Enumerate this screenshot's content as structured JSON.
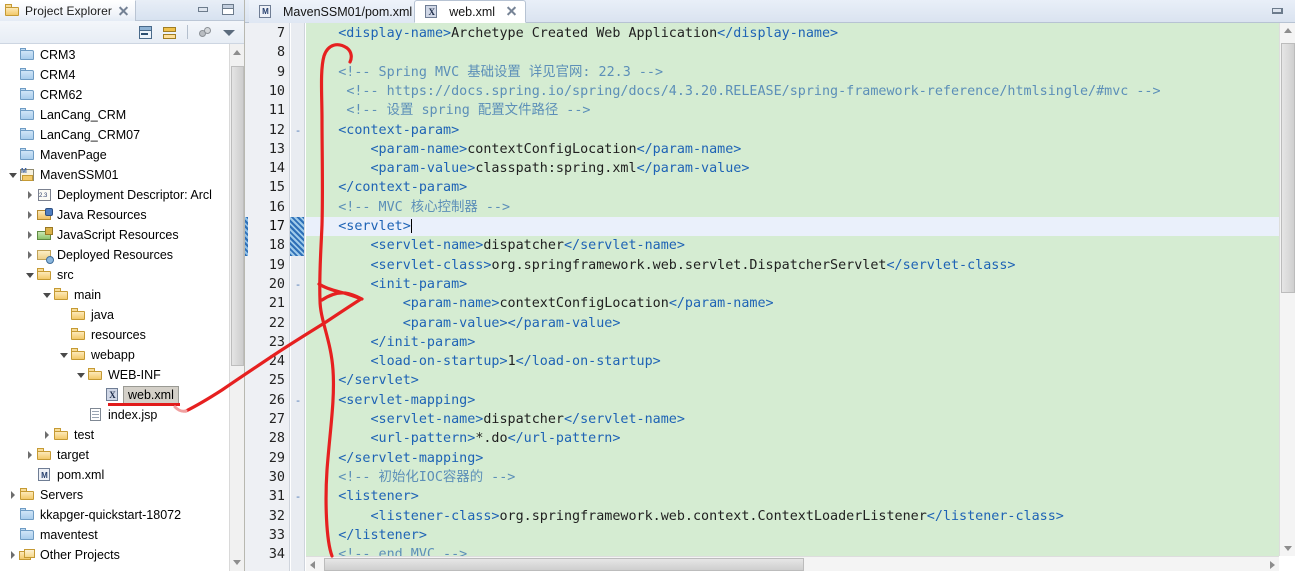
{
  "window": {
    "restore_label": "restore-down"
  },
  "explorer": {
    "tab_title": "Project Explorer",
    "close_icon": "close-icon",
    "minimize_icon": "minimize-icon",
    "maximize_icon": "maximize-icon",
    "toolbar": {
      "collapse_all": "collapse-all-icon",
      "link_with_editor": "link-with-editor-icon",
      "filter": "filter-icon",
      "view_menu": "view-menu-icon"
    },
    "tree": [
      {
        "label": "CRM3",
        "indent": 0,
        "twisty": "none",
        "icon": "folder-blue"
      },
      {
        "label": "CRM4",
        "indent": 0,
        "twisty": "none",
        "icon": "folder-blue"
      },
      {
        "label": "CRM62",
        "indent": 0,
        "twisty": "none",
        "icon": "folder-blue"
      },
      {
        "label": "LanCang_CRM",
        "indent": 0,
        "twisty": "none",
        "icon": "folder-blue"
      },
      {
        "label": "LanCang_CRM07",
        "indent": 0,
        "twisty": "none",
        "icon": "folder-blue"
      },
      {
        "label": "MavenPage",
        "indent": 0,
        "twisty": "none",
        "icon": "folder-blue"
      },
      {
        "label": "MavenSSM01",
        "indent": 0,
        "twisty": "open",
        "icon": "maven-project"
      },
      {
        "label": "Deployment Descriptor: Arcl",
        "indent": 1,
        "twisty": "closed",
        "icon": "deployment-descriptor"
      },
      {
        "label": "Java Resources",
        "indent": 1,
        "twisty": "closed",
        "icon": "java-resources"
      },
      {
        "label": "JavaScript Resources",
        "indent": 1,
        "twisty": "closed",
        "icon": "javascript-resources"
      },
      {
        "label": "Deployed Resources",
        "indent": 1,
        "twisty": "closed",
        "icon": "deployed-resources"
      },
      {
        "label": "src",
        "indent": 1,
        "twisty": "open",
        "icon": "folder-yellow"
      },
      {
        "label": "main",
        "indent": 2,
        "twisty": "open",
        "icon": "folder-yellow"
      },
      {
        "label": "java",
        "indent": 3,
        "twisty": "none",
        "icon": "folder-yellow"
      },
      {
        "label": "resources",
        "indent": 3,
        "twisty": "none",
        "icon": "folder-yellow"
      },
      {
        "label": "webapp",
        "indent": 3,
        "twisty": "open",
        "icon": "folder-yellow"
      },
      {
        "label": "WEB-INF",
        "indent": 4,
        "twisty": "open",
        "icon": "folder-yellow"
      },
      {
        "label": "web.xml",
        "indent": 5,
        "twisty": "none",
        "icon": "xml-file",
        "selected": true
      },
      {
        "label": "index.jsp",
        "indent": 4,
        "twisty": "none",
        "icon": "jsp-file"
      },
      {
        "label": "test",
        "indent": 2,
        "twisty": "closed",
        "icon": "folder-yellow"
      },
      {
        "label": "target",
        "indent": 1,
        "twisty": "closed",
        "icon": "folder-yellow"
      },
      {
        "label": "pom.xml",
        "indent": 1,
        "twisty": "none",
        "icon": "pom-file"
      },
      {
        "label": "Servers",
        "indent": 0,
        "twisty": "closed",
        "icon": "folder-yellow"
      },
      {
        "label": "kkapger-quickstart-18072",
        "indent": 0,
        "twisty": "none",
        "icon": "folder-blue"
      },
      {
        "label": "maventest",
        "indent": 0,
        "twisty": "none",
        "icon": "folder-blue"
      },
      {
        "label": "Other Projects",
        "indent": -1,
        "twisty": "closed",
        "icon": "other-projects"
      }
    ]
  },
  "editor": {
    "tabs": [
      {
        "label": "MavenSSM01/pom.xml",
        "icon": "pom-file",
        "active": false,
        "closable": false
      },
      {
        "label": "web.xml",
        "icon": "xml-file",
        "active": true,
        "closable": true
      }
    ],
    "minimize_icon": "minimize-icon",
    "current_line": 17,
    "first_line": 7,
    "lines": [
      {
        "n": 7,
        "fold": "",
        "text": "    <display-name>Archetype Created Web Application</display-name>"
      },
      {
        "n": 8,
        "fold": "",
        "text": ""
      },
      {
        "n": 9,
        "fold": "",
        "text": "    <!-- Spring MVC 基础设置 详见官网: 22.3 -->"
      },
      {
        "n": 10,
        "fold": "",
        "text": "     <!-- https://docs.spring.io/spring/docs/4.3.20.RELEASE/spring-framework-reference/htmlsingle/#mvc -->"
      },
      {
        "n": 11,
        "fold": "",
        "text": "     <!-- 设置 spring 配置文件路径 -->"
      },
      {
        "n": 12,
        "fold": "-",
        "text": "    <context-param>"
      },
      {
        "n": 13,
        "fold": "",
        "text": "        <param-name>contextConfigLocation</param-name>"
      },
      {
        "n": 14,
        "fold": "",
        "text": "        <param-value>classpath:spring.xml</param-value>"
      },
      {
        "n": 15,
        "fold": "",
        "text": "    </context-param>"
      },
      {
        "n": 16,
        "fold": "",
        "text": "    <!-- MVC 核心控制器 -->"
      },
      {
        "n": 17,
        "fold": "-",
        "text": "    <servlet>"
      },
      {
        "n": 18,
        "fold": "",
        "text": "        <servlet-name>dispatcher</servlet-name>"
      },
      {
        "n": 19,
        "fold": "",
        "text": "        <servlet-class>org.springframework.web.servlet.DispatcherServlet</servlet-class>"
      },
      {
        "n": 20,
        "fold": "-",
        "text": "        <init-param>"
      },
      {
        "n": 21,
        "fold": "",
        "text": "            <param-name>contextConfigLocation</param-name>"
      },
      {
        "n": 22,
        "fold": "",
        "text": "            <param-value></param-value>"
      },
      {
        "n": 23,
        "fold": "",
        "text": "        </init-param>"
      },
      {
        "n": 24,
        "fold": "",
        "text": "        <load-on-startup>1</load-on-startup>"
      },
      {
        "n": 25,
        "fold": "",
        "text": "    </servlet>"
      },
      {
        "n": 26,
        "fold": "-",
        "text": "    <servlet-mapping>"
      },
      {
        "n": 27,
        "fold": "",
        "text": "        <servlet-name>dispatcher</servlet-name>"
      },
      {
        "n": 28,
        "fold": "",
        "text": "        <url-pattern>*.do</url-pattern>"
      },
      {
        "n": 29,
        "fold": "",
        "text": "    </servlet-mapping>"
      },
      {
        "n": 30,
        "fold": "",
        "text": "    <!-- 初始化IOC容器的 -->"
      },
      {
        "n": 31,
        "fold": "-",
        "text": "    <listener>"
      },
      {
        "n": 32,
        "fold": "",
        "text": "        <listener-class>org.springframework.web.context.ContextLoaderListener</listener-class>"
      },
      {
        "n": 33,
        "fold": "",
        "text": "    </listener>"
      },
      {
        "n": 34,
        "fold": "",
        "text": "    <!-- end MVC -->"
      }
    ]
  },
  "annotation": {
    "color": "#e62020",
    "description": "hand-drawn red arrow from web.xml tree node to the servlet block in the editor"
  },
  "colors": {
    "editor_background": "#d5ecd2",
    "tag_color": "#1e63b5",
    "comment_color": "#5c8fb8",
    "text_color": "#1f1f1f",
    "annotation_red": "#e62020",
    "current_line": "#eaf0fb"
  }
}
